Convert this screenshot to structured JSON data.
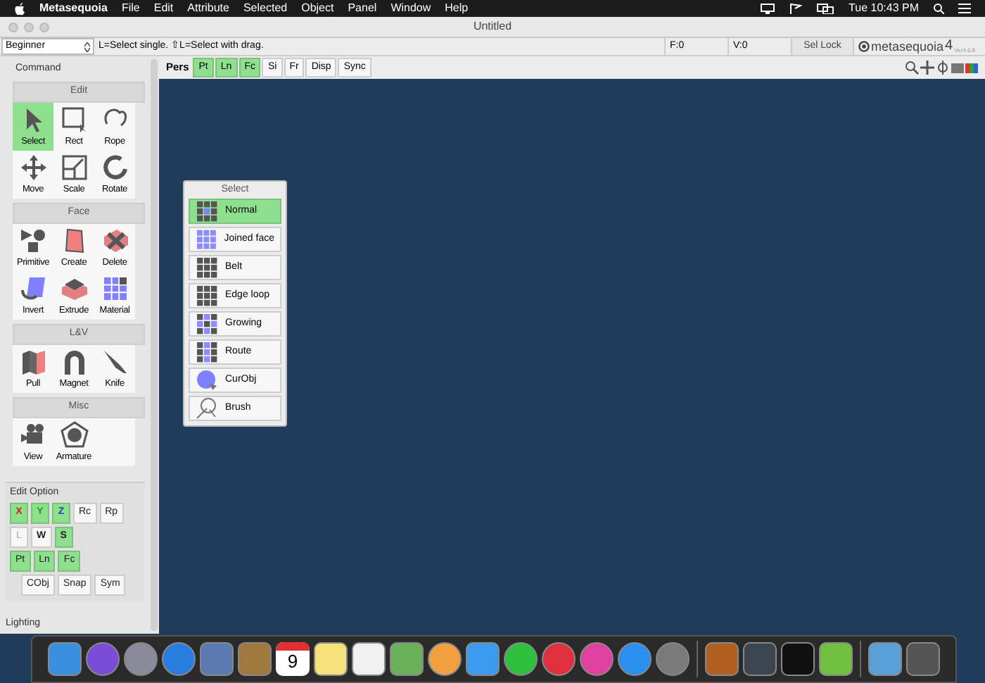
{
  "menu_bar": {
    "app": "Metasequoia",
    "items": [
      "File",
      "Edit",
      "Attribute",
      "Selected",
      "Object",
      "Panel",
      "Window",
      "Help"
    ],
    "clock": "Tue 10:43 PM"
  },
  "window": {
    "title": "Untitled"
  },
  "toolbar": {
    "mode": "Beginner",
    "hint": "L=Select single.  ⇧L=Select with drag.",
    "faces": "F:0",
    "vertices": "V:0",
    "sel_lock": "Sel Lock",
    "logo": "metasequoia",
    "logo_digit": "4",
    "version": "Ver4.6.8"
  },
  "command_panel": {
    "title": "Command",
    "sections": [
      {
        "title": "Edit",
        "tools": [
          {
            "label": "Select",
            "selected": true
          },
          {
            "label": "Rect",
            "selected": false
          },
          {
            "label": "Rope",
            "selected": false
          },
          {
            "label": "Move",
            "selected": false
          },
          {
            "label": "Scale",
            "selected": false
          },
          {
            "label": "Rotate",
            "selected": false
          }
        ]
      },
      {
        "title": "Face",
        "tools": [
          {
            "label": "Primitive",
            "selected": false
          },
          {
            "label": "Create",
            "selected": false
          },
          {
            "label": "Delete",
            "selected": false
          },
          {
            "label": "Invert",
            "selected": false
          },
          {
            "label": "Extrude",
            "selected": false
          },
          {
            "label": "Material",
            "selected": false
          }
        ]
      },
      {
        "title": "L&V",
        "tools": [
          {
            "label": "Pull",
            "selected": false
          },
          {
            "label": "Magnet",
            "selected": false
          },
          {
            "label": "Knife",
            "selected": false
          }
        ]
      },
      {
        "title": "Misc",
        "tools": [
          {
            "label": "View",
            "selected": false
          },
          {
            "label": "Armature",
            "selected": false
          }
        ]
      }
    ]
  },
  "edit_option": {
    "title": "Edit Option",
    "axes": [
      {
        "label": "X",
        "on": true,
        "disabled": false,
        "kind": "axis"
      },
      {
        "label": "Y",
        "on": true,
        "disabled": false,
        "kind": "axis"
      },
      {
        "label": "Z",
        "on": true,
        "disabled": false,
        "kind": "axis"
      },
      {
        "label": "Rc",
        "on": false,
        "disabled": false,
        "kind": "plain"
      },
      {
        "label": "Rp",
        "on": false,
        "disabled": false,
        "kind": "plain"
      }
    ],
    "coords": [
      {
        "label": "L",
        "on": false,
        "disabled": true,
        "kind": "bold"
      },
      {
        "label": "W",
        "on": false,
        "disabled": false,
        "kind": "bold"
      },
      {
        "label": "S",
        "on": true,
        "disabled": false,
        "kind": "bold"
      }
    ],
    "elements": [
      {
        "label": "Pt",
        "on": true,
        "disabled": false
      },
      {
        "label": "Ln",
        "on": true,
        "disabled": false
      },
      {
        "label": "Fc",
        "on": true,
        "disabled": false
      }
    ],
    "extras": [
      {
        "label": "CObj",
        "on": false,
        "disabled": false
      },
      {
        "label": "Snap",
        "on": false,
        "disabled": false
      },
      {
        "label": "Sym",
        "on": false,
        "disabled": false
      }
    ]
  },
  "lighting": {
    "title": "Lighting"
  },
  "view_tabs": [
    {
      "label": "Pers",
      "kind": "title"
    },
    {
      "label": "Pt",
      "on": true,
      "kind": "toggle"
    },
    {
      "label": "Ln",
      "on": true,
      "kind": "toggle"
    },
    {
      "label": "Fc",
      "on": true,
      "kind": "toggle"
    },
    {
      "label": "Si",
      "on": false,
      "kind": "toggle"
    },
    {
      "label": "Fr",
      "on": false,
      "kind": "toggle"
    },
    {
      "label": "Disp",
      "on": false,
      "kind": "toggle"
    },
    {
      "label": "Sync",
      "on": false,
      "kind": "toggle"
    }
  ],
  "select_panel": {
    "title": "Select",
    "items": [
      {
        "label": "Normal",
        "selected": true
      },
      {
        "label": "Joined face",
        "selected": false
      },
      {
        "label": "Belt",
        "selected": false
      },
      {
        "label": "Edge loop",
        "selected": false
      },
      {
        "label": "Growing",
        "selected": false
      },
      {
        "label": "Route",
        "selected": false
      },
      {
        "label": "CurObj",
        "selected": false
      },
      {
        "label": "Brush",
        "selected": false
      }
    ]
  },
  "dock": {
    "calendar_day": "9"
  }
}
